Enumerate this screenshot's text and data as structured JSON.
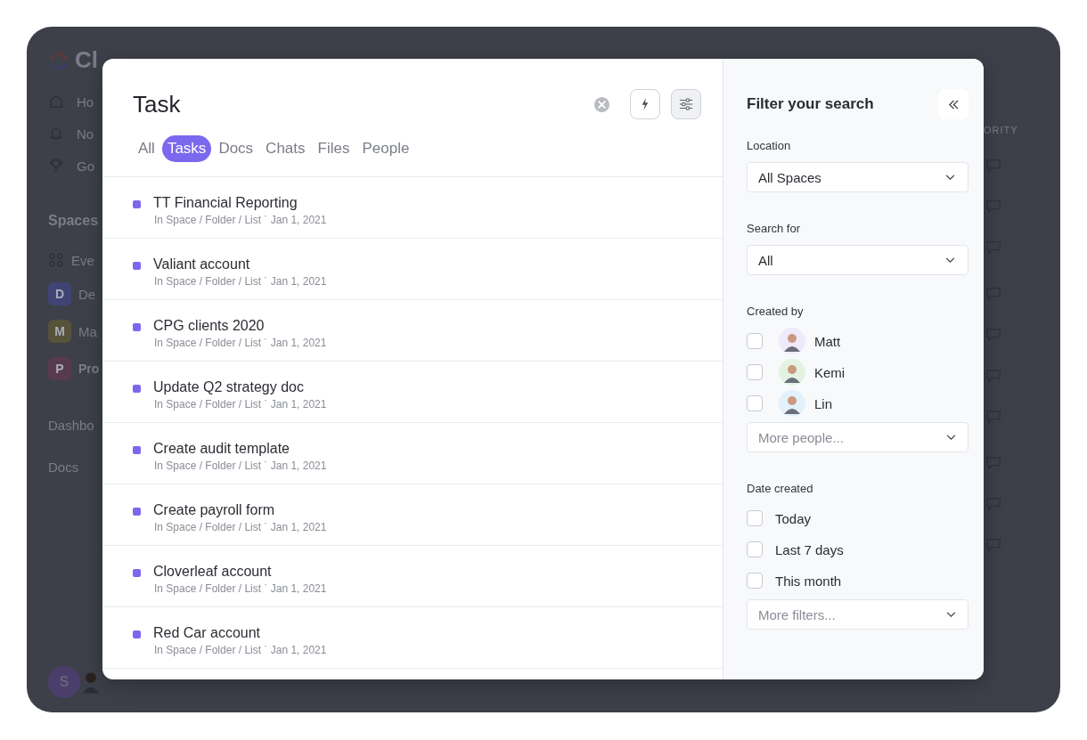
{
  "background": {
    "logo_text": "Cl",
    "nav": [
      {
        "label": "Ho",
        "kind": "home"
      },
      {
        "label": "No",
        "kind": "bell"
      },
      {
        "label": "Go",
        "kind": "trophy"
      }
    ],
    "spaces_title": "Spaces",
    "spaces": [
      {
        "label": "Eve",
        "kind": "all"
      },
      {
        "label": "De",
        "kind": "space",
        "letter": "D",
        "color": "#3f4474"
      },
      {
        "label": "Ma",
        "kind": "space",
        "letter": "M",
        "color": "#57523a"
      },
      {
        "label": "Pro",
        "kind": "space",
        "letter": "P",
        "color": "#583a4d"
      }
    ],
    "links": [
      "Dashbo",
      "Docs"
    ],
    "user_initial": "S",
    "column_header": "ORITY"
  },
  "search": {
    "query": "Task",
    "tabs": [
      {
        "label": "All",
        "selected": false
      },
      {
        "label": "Tasks",
        "selected": true
      },
      {
        "label": "Docs",
        "selected": false
      },
      {
        "label": "Chats",
        "selected": false
      },
      {
        "label": "Files",
        "selected": false
      },
      {
        "label": "People",
        "selected": false
      }
    ],
    "results": [
      {
        "title": "TT Financial Reporting",
        "meta": "In Space / Folder / List ˙ Jan 1, 2021"
      },
      {
        "title": "Valiant account",
        "meta": "In Space / Folder / List ˙ Jan 1, 2021"
      },
      {
        "title": "CPG clients 2020",
        "meta": "In Space / Folder / List ˙ Jan 1, 2021"
      },
      {
        "title": "Update Q2 strategy doc",
        "meta": "In Space / Folder / List ˙ Jan 1, 2021"
      },
      {
        "title": "Create audit template",
        "meta": "In Space / Folder / List ˙ Jan 1, 2021"
      },
      {
        "title": "Create payroll form",
        "meta": "In Space / Folder / List ˙ Jan 1, 2021"
      },
      {
        "title": "Cloverleaf account",
        "meta": "In Space / Folder / List ˙ Jan 1, 2021"
      },
      {
        "title": "Red Car account",
        "meta": "In Space / Folder / List ˙ Jan 1, 2021"
      }
    ]
  },
  "filters": {
    "title": "Filter your search",
    "location": {
      "label": "Location",
      "value": "All Spaces"
    },
    "search_for": {
      "label": "Search for",
      "value": "All"
    },
    "created_by": {
      "label": "Created by",
      "people": [
        {
          "name": "Matt",
          "checked": false,
          "color": "#efeafb"
        },
        {
          "name": "Kemi",
          "checked": false,
          "color": "#e3f3e1"
        },
        {
          "name": "Lin",
          "checked": false,
          "color": "#e2f1fb"
        }
      ],
      "more": {
        "placeholder": "More people..."
      }
    },
    "date_created": {
      "label": "Date created",
      "options": [
        {
          "label": "Today",
          "checked": false
        },
        {
          "label": "Last 7 days",
          "checked": false
        },
        {
          "label": "This month",
          "checked": false
        }
      ],
      "more": {
        "placeholder": "More filters..."
      }
    }
  }
}
